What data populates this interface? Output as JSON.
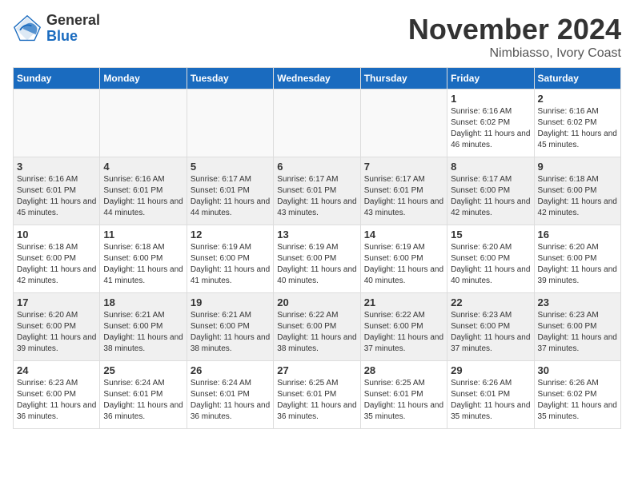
{
  "header": {
    "logo_general": "General",
    "logo_blue": "Blue",
    "month_title": "November 2024",
    "location": "Nimbiasso, Ivory Coast"
  },
  "weekdays": [
    "Sunday",
    "Monday",
    "Tuesday",
    "Wednesday",
    "Thursday",
    "Friday",
    "Saturday"
  ],
  "weeks": [
    [
      {
        "day": "",
        "info": ""
      },
      {
        "day": "",
        "info": ""
      },
      {
        "day": "",
        "info": ""
      },
      {
        "day": "",
        "info": ""
      },
      {
        "day": "",
        "info": ""
      },
      {
        "day": "1",
        "info": "Sunrise: 6:16 AM\nSunset: 6:02 PM\nDaylight: 11 hours and 46 minutes."
      },
      {
        "day": "2",
        "info": "Sunrise: 6:16 AM\nSunset: 6:02 PM\nDaylight: 11 hours and 45 minutes."
      }
    ],
    [
      {
        "day": "3",
        "info": "Sunrise: 6:16 AM\nSunset: 6:01 PM\nDaylight: 11 hours and 45 minutes."
      },
      {
        "day": "4",
        "info": "Sunrise: 6:16 AM\nSunset: 6:01 PM\nDaylight: 11 hours and 44 minutes."
      },
      {
        "day": "5",
        "info": "Sunrise: 6:17 AM\nSunset: 6:01 PM\nDaylight: 11 hours and 44 minutes."
      },
      {
        "day": "6",
        "info": "Sunrise: 6:17 AM\nSunset: 6:01 PM\nDaylight: 11 hours and 43 minutes."
      },
      {
        "day": "7",
        "info": "Sunrise: 6:17 AM\nSunset: 6:01 PM\nDaylight: 11 hours and 43 minutes."
      },
      {
        "day": "8",
        "info": "Sunrise: 6:17 AM\nSunset: 6:00 PM\nDaylight: 11 hours and 42 minutes."
      },
      {
        "day": "9",
        "info": "Sunrise: 6:18 AM\nSunset: 6:00 PM\nDaylight: 11 hours and 42 minutes."
      }
    ],
    [
      {
        "day": "10",
        "info": "Sunrise: 6:18 AM\nSunset: 6:00 PM\nDaylight: 11 hours and 42 minutes."
      },
      {
        "day": "11",
        "info": "Sunrise: 6:18 AM\nSunset: 6:00 PM\nDaylight: 11 hours and 41 minutes."
      },
      {
        "day": "12",
        "info": "Sunrise: 6:19 AM\nSunset: 6:00 PM\nDaylight: 11 hours and 41 minutes."
      },
      {
        "day": "13",
        "info": "Sunrise: 6:19 AM\nSunset: 6:00 PM\nDaylight: 11 hours and 40 minutes."
      },
      {
        "day": "14",
        "info": "Sunrise: 6:19 AM\nSunset: 6:00 PM\nDaylight: 11 hours and 40 minutes."
      },
      {
        "day": "15",
        "info": "Sunrise: 6:20 AM\nSunset: 6:00 PM\nDaylight: 11 hours and 40 minutes."
      },
      {
        "day": "16",
        "info": "Sunrise: 6:20 AM\nSunset: 6:00 PM\nDaylight: 11 hours and 39 minutes."
      }
    ],
    [
      {
        "day": "17",
        "info": "Sunrise: 6:20 AM\nSunset: 6:00 PM\nDaylight: 11 hours and 39 minutes."
      },
      {
        "day": "18",
        "info": "Sunrise: 6:21 AM\nSunset: 6:00 PM\nDaylight: 11 hours and 38 minutes."
      },
      {
        "day": "19",
        "info": "Sunrise: 6:21 AM\nSunset: 6:00 PM\nDaylight: 11 hours and 38 minutes."
      },
      {
        "day": "20",
        "info": "Sunrise: 6:22 AM\nSunset: 6:00 PM\nDaylight: 11 hours and 38 minutes."
      },
      {
        "day": "21",
        "info": "Sunrise: 6:22 AM\nSunset: 6:00 PM\nDaylight: 11 hours and 37 minutes."
      },
      {
        "day": "22",
        "info": "Sunrise: 6:23 AM\nSunset: 6:00 PM\nDaylight: 11 hours and 37 minutes."
      },
      {
        "day": "23",
        "info": "Sunrise: 6:23 AM\nSunset: 6:00 PM\nDaylight: 11 hours and 37 minutes."
      }
    ],
    [
      {
        "day": "24",
        "info": "Sunrise: 6:23 AM\nSunset: 6:00 PM\nDaylight: 11 hours and 36 minutes."
      },
      {
        "day": "25",
        "info": "Sunrise: 6:24 AM\nSunset: 6:01 PM\nDaylight: 11 hours and 36 minutes."
      },
      {
        "day": "26",
        "info": "Sunrise: 6:24 AM\nSunset: 6:01 PM\nDaylight: 11 hours and 36 minutes."
      },
      {
        "day": "27",
        "info": "Sunrise: 6:25 AM\nSunset: 6:01 PM\nDaylight: 11 hours and 36 minutes."
      },
      {
        "day": "28",
        "info": "Sunrise: 6:25 AM\nSunset: 6:01 PM\nDaylight: 11 hours and 35 minutes."
      },
      {
        "day": "29",
        "info": "Sunrise: 6:26 AM\nSunset: 6:01 PM\nDaylight: 11 hours and 35 minutes."
      },
      {
        "day": "30",
        "info": "Sunrise: 6:26 AM\nSunset: 6:02 PM\nDaylight: 11 hours and 35 minutes."
      }
    ]
  ]
}
